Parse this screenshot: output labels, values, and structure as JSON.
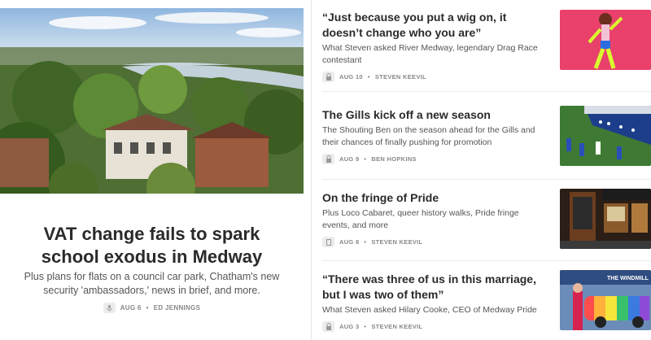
{
  "featured": {
    "title": "VAT change fails to spark school exodus in Medway",
    "subtitle": "Plus plans for flats on a council car park, Chatham's new security 'ambassadors,' news in brief, and more.",
    "date": "AUG 6",
    "author": "ED JENNINGS",
    "image_icon": "town-river-photo"
  },
  "posts": [
    {
      "title": "“Just because you put a wig on, it doesn’t change who you are”",
      "subtitle": "What Steven asked River Medway, legendary Drag Race contestant",
      "date": "AUG 10",
      "author": "STEVEN KEEVIL",
      "locked": true,
      "thumb": "drag-performer-photo"
    },
    {
      "title": "The Gills kick off a new season",
      "subtitle": "The Shouting Ben on the season ahead for the Gills and their chances of finally pushing for promotion",
      "date": "AUG 9",
      "author": "BEN HOPKINS",
      "locked": true,
      "thumb": "football-match-photo"
    },
    {
      "title": "On the fringe of Pride",
      "subtitle": "Plus Loco Cabaret, queer history walks, Pride fringe events, and more",
      "date": "AUG 8",
      "author": "STEVEN KEEVIL",
      "locked": false,
      "thumb": "pub-front-photo"
    },
    {
      "title": "“There was three of us in this marriage, but I was two of them”",
      "subtitle": "What Steven asked Hilary Cooke, CEO of Medway Pride",
      "date": "AUG 3",
      "author": "STEVEN KEEVIL",
      "locked": true,
      "thumb": "rainbow-car-photo",
      "thumb_sign": "THE WINDMILL"
    }
  ],
  "separator": "•",
  "colors": {
    "meta": "#888888",
    "title": "#2a2a2a",
    "divider": "#e6e6e6"
  }
}
